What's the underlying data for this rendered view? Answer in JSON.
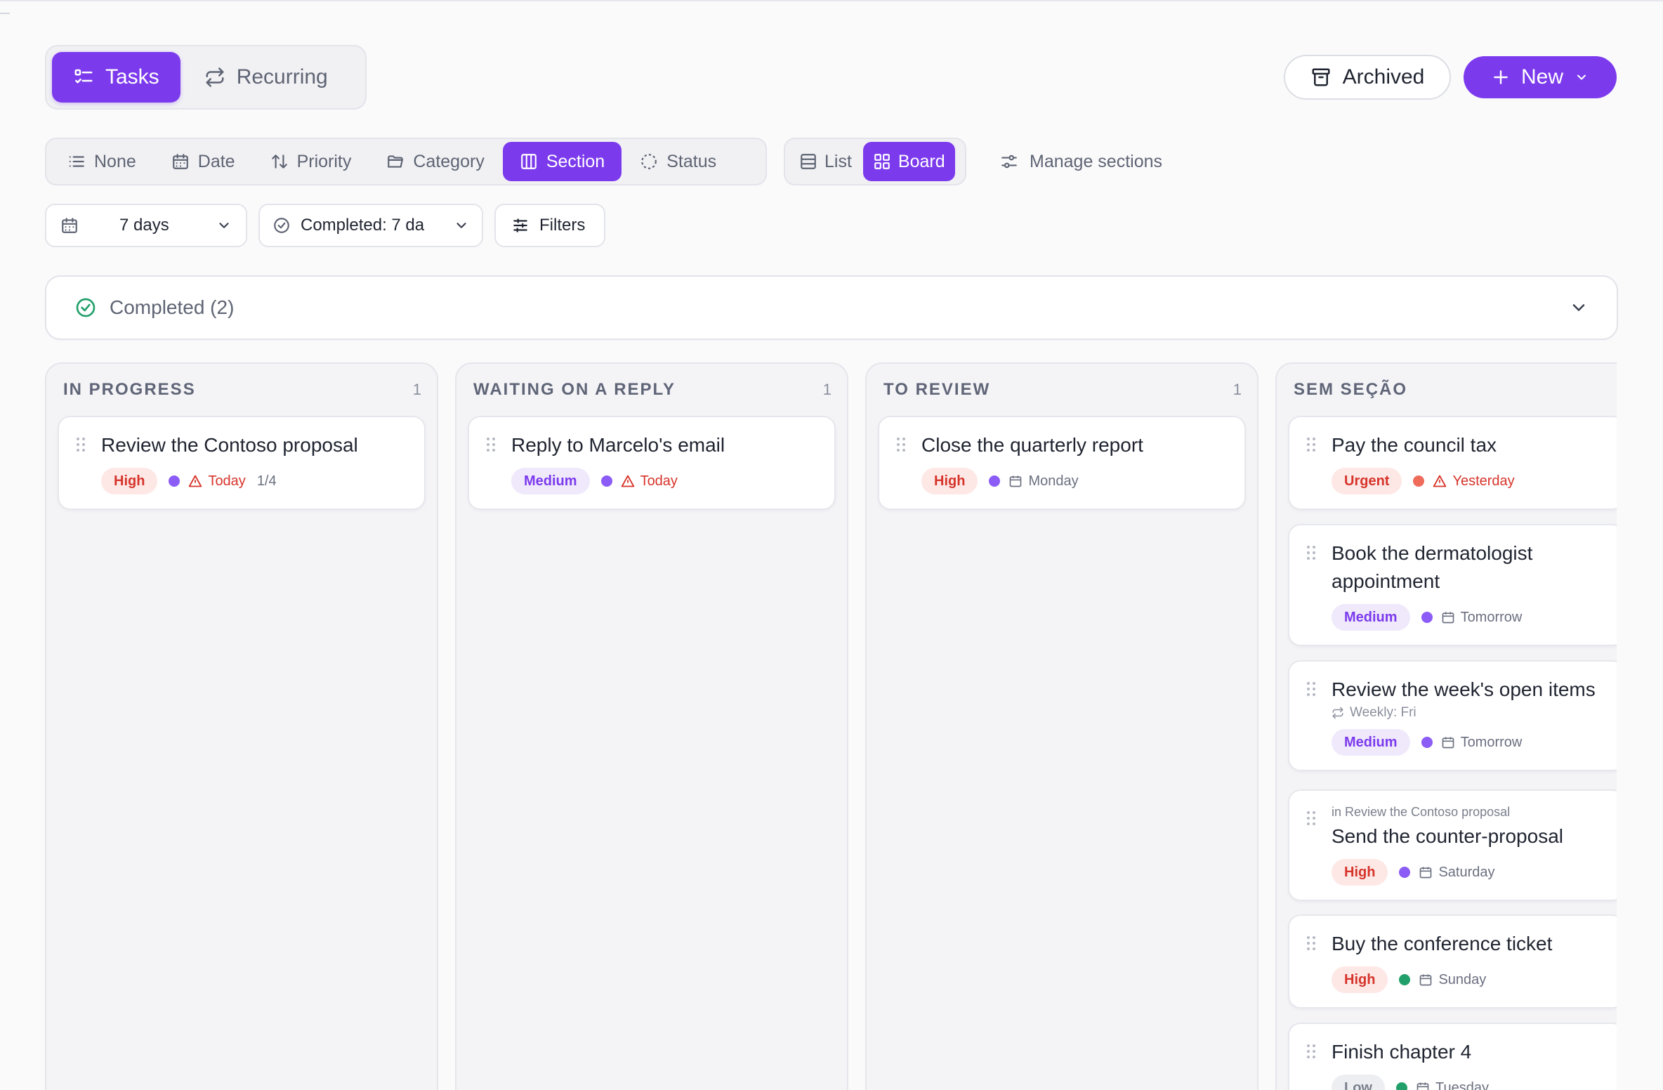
{
  "colors": {
    "accent": "#7c3aed",
    "priority_high": "#d6342a",
    "priority_medium": "#7c3aed",
    "priority_low": "#7a7f8c",
    "dot_purple": "#8b5cf6",
    "dot_orange": "#ef6b5a",
    "dot_green": "#22a06b",
    "success_icon": "#22a06b"
  },
  "mode_tabs": [
    {
      "label": "Tasks",
      "icon": "list-check-icon",
      "active": true
    },
    {
      "label": "Recurring",
      "icon": "repeat-icon",
      "active": false
    }
  ],
  "header": {
    "archived_label": "Archived",
    "new_label": "New"
  },
  "group_by": [
    {
      "label": "None",
      "icon": "list-icon",
      "active": false
    },
    {
      "label": "Date",
      "icon": "calendar-icon",
      "active": false
    },
    {
      "label": "Priority",
      "icon": "sort-icon",
      "active": false
    },
    {
      "label": "Category",
      "icon": "folder-icon",
      "active": false
    },
    {
      "label": "Section",
      "icon": "columns-icon",
      "active": true
    },
    {
      "label": "Status",
      "icon": "status-circle-icon",
      "active": false
    }
  ],
  "view_mode": [
    {
      "label": "List",
      "icon": "list-view-icon",
      "active": false
    },
    {
      "label": "Board",
      "icon": "board-grid-icon",
      "active": true
    }
  ],
  "manage_sections_label": "Manage sections",
  "filters": {
    "days_label": "7 days",
    "completed_label": "Completed: 7 da",
    "filters_label": "Filters"
  },
  "completed_section": {
    "label": "Completed (2)"
  },
  "columns": [
    {
      "title": "IN PROGRESS",
      "count": "1",
      "cards": [
        {
          "title": "Review the Contoso proposal",
          "priority": "High",
          "dot": "purple",
          "due": "Today",
          "due_overdue": true,
          "subtasks": "1/4"
        }
      ]
    },
    {
      "title": "WAITING ON A REPLY",
      "count": "1",
      "cards": [
        {
          "title": "Reply to Marcelo's email",
          "priority": "Medium",
          "dot": "purple",
          "due": "Today",
          "due_overdue": true
        }
      ]
    },
    {
      "title": "TO REVIEW",
      "count": "1",
      "cards": [
        {
          "title": "Close the quarterly report",
          "priority": "High",
          "dot": "purple",
          "due": "Monday",
          "due_overdue": false
        }
      ]
    },
    {
      "title": "SEM SEÇÃO",
      "cards": [
        {
          "title": "Pay the council tax",
          "priority": "Urgent",
          "dot": "orange",
          "due": "Yesterday",
          "due_overdue": true
        },
        {
          "title": "Book the dermatologist appointment",
          "priority": "Medium",
          "dot": "purple",
          "due": "Tomorrow",
          "due_overdue": false
        },
        {
          "title": "Review the week's open items",
          "recurrence": "Weekly: Fri",
          "priority": "Medium",
          "dot": "purple",
          "due": "Tomorrow",
          "due_overdue": false
        },
        {
          "parent": "in Review the Contoso proposal",
          "title": "Send the counter-proposal",
          "priority": "High",
          "dot": "purple",
          "due": "Saturday",
          "due_overdue": false
        },
        {
          "title": "Buy the conference ticket",
          "priority": "High",
          "dot": "green",
          "due": "Sunday",
          "due_overdue": false
        },
        {
          "title": "Finish chapter 4",
          "priority": "Low",
          "dot": "green",
          "due": "Tuesday",
          "due_overdue": false
        }
      ]
    }
  ]
}
